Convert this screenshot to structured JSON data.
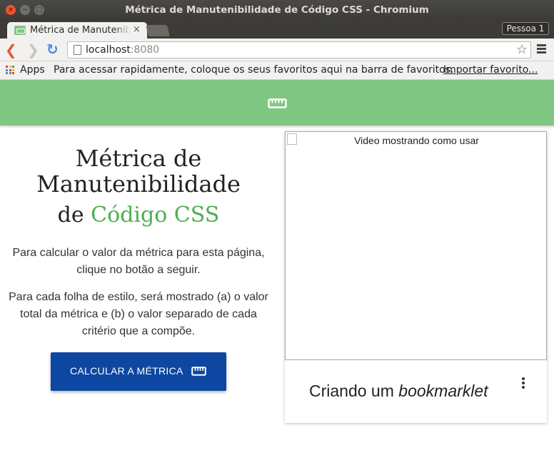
{
  "window": {
    "title": "Métrica de Manutenibilidade de Código CSS - Chromium",
    "close_glyph": "×",
    "min_glyph": "−",
    "max_glyph": "□"
  },
  "tabs": {
    "active_label": "Métrica de Manutenibilidade",
    "close_glyph": "×",
    "profile_label": "Pessoa 1"
  },
  "toolbar": {
    "url_host": "localhost",
    "url_port": ":8080"
  },
  "bookmarks": {
    "apps_label": "Apps",
    "hint": "Para acessar rapidamente, coloque os seus favoritos aqui na barra de favoritos.",
    "import_label": "Importar favorito..."
  },
  "colors": {
    "header_green": "#81c784",
    "accent_green": "#4caf50",
    "button_blue": "#0d47a1"
  },
  "main": {
    "title_line1": "Métrica de",
    "title_line2": "Manutenibilidade",
    "title_sub_prefix": "de ",
    "title_sub_accent": "Código CSS",
    "paragraph1": "Para calcular o valor da métrica para esta página, clique no botão a seguir.",
    "paragraph2": "Para cada folha de estilo, será mostrado (a) o valor total da métrica e (b) o valor separado de cada critério que a compõe.",
    "calc_button_label": "CALCULAR A MÉTRICA"
  },
  "video_card": {
    "image_alt": "Video mostrando como usar",
    "title_prefix": "Criando um ",
    "title_italic": "bookmarklet"
  }
}
